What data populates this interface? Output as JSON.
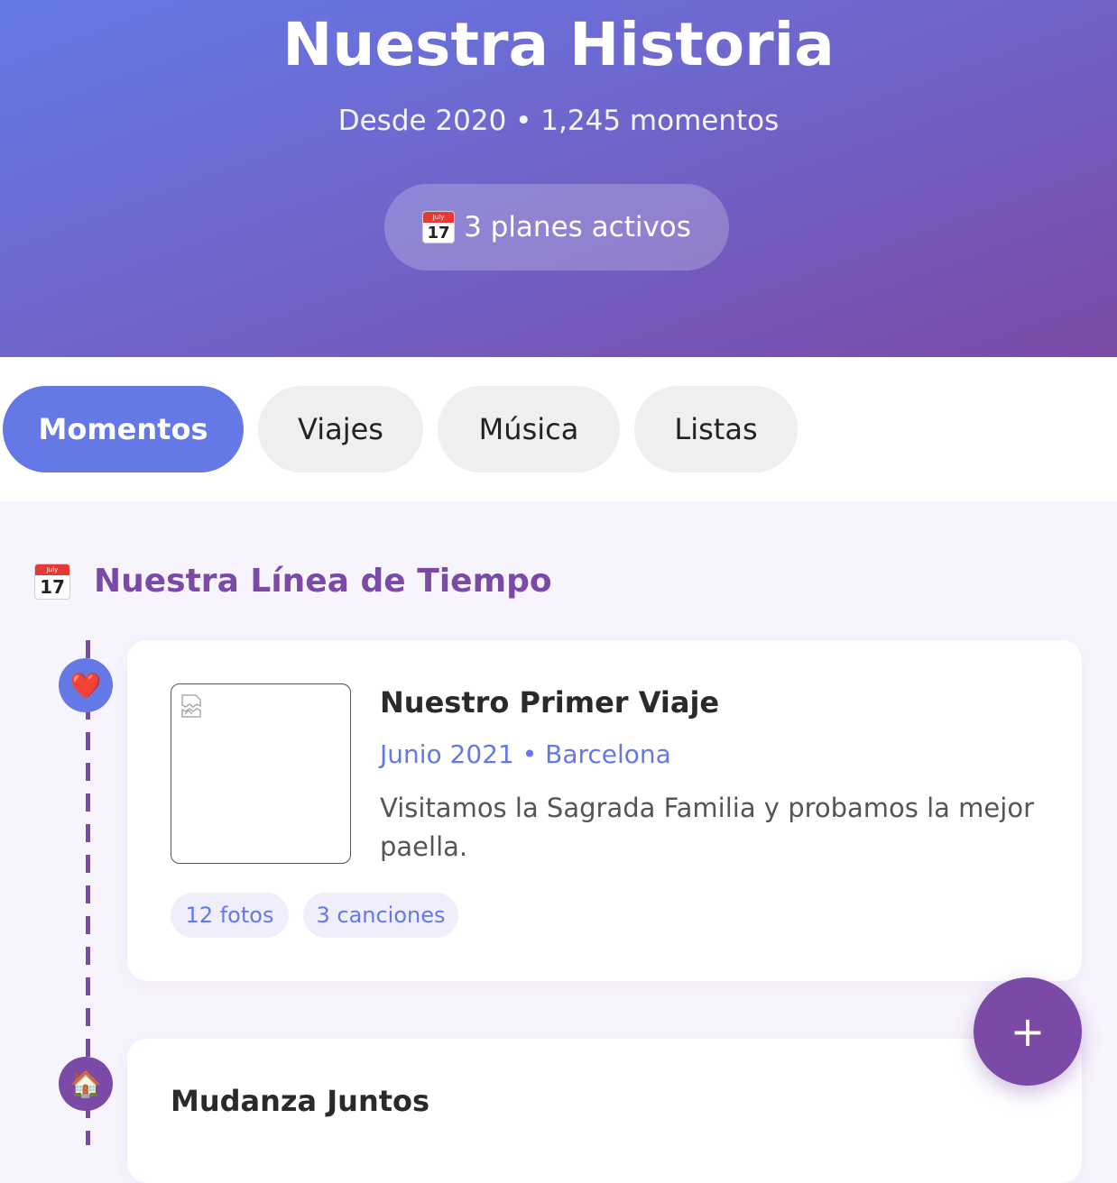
{
  "header": {
    "title": "Nuestra Historia",
    "subtitle": "Desde 2020 • 1,245 momentos",
    "plans_icon": "calendar-icon",
    "plans_label": "3 planes activos"
  },
  "calendar_icon": {
    "month": "July",
    "day": "17"
  },
  "tabs": [
    {
      "label": "Momentos",
      "active": true
    },
    {
      "label": "Viajes",
      "active": false
    },
    {
      "label": "Música",
      "active": false
    },
    {
      "label": "Listas",
      "active": false
    }
  ],
  "section": {
    "icon": "calendar-icon",
    "title": "Nuestra Línea de Tiempo"
  },
  "moments": [
    {
      "icon": "heart-icon",
      "icon_glyph": "❤️",
      "image_icon": "broken-image-icon",
      "title": "Nuestro Primer Viaje",
      "meta": "Junio 2021 • Barcelona",
      "description": "Visitamos la Sagrada Familia y probamos la mejor paella.",
      "chips": [
        "12 fotos",
        "3 canciones"
      ]
    },
    {
      "icon": "house-icon",
      "icon_glyph": "🏠",
      "title": "Mudanza Juntos"
    }
  ],
  "fab": {
    "icon": "plus-icon",
    "label": "+"
  },
  "colors": {
    "primary": "#6479e6",
    "secondary": "#7a4aa6",
    "background": "#f7f4fd",
    "tab_inactive": "#efefef"
  }
}
